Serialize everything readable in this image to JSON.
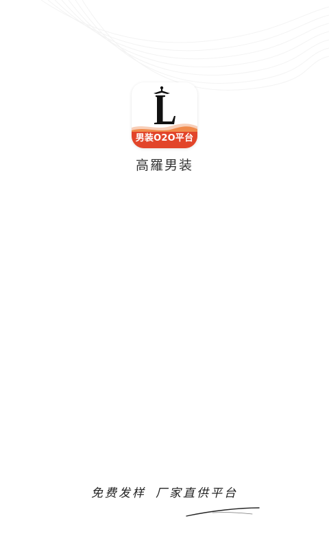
{
  "app": {
    "icon_banner_text": "男装O2O平台",
    "icon_letter": "L",
    "name": "高羅男装"
  },
  "slogan": {
    "part1": "免费发样",
    "part2": "厂家直供平台"
  },
  "colors": {
    "brand_red": "#e2452a",
    "brand_orange": "#f08a4b",
    "text_dark": "#333333"
  }
}
